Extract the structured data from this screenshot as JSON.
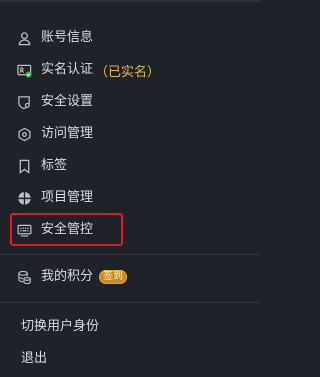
{
  "menu": {
    "account_info": {
      "label": "账号信息",
      "icon": "user-icon"
    },
    "real_name": {
      "label": "实名认证",
      "status": "（已实名）",
      "icon": "id-card-verified-icon",
      "status_color": "#e5b54f"
    },
    "security_settings": {
      "label": "安全设置",
      "icon": "shield-settings-icon"
    },
    "access_management": {
      "label": "访问管理",
      "icon": "access-management-icon"
    },
    "tags": {
      "label": "标签",
      "icon": "bookmark-icon"
    },
    "project_management": {
      "label": "项目管理",
      "icon": "project-icon"
    },
    "security_control": {
      "label": "安全管控",
      "icon": "keyboard-icon",
      "highlighted": true
    },
    "my_points": {
      "label": "我的积分",
      "badge": "签到",
      "icon": "coins-icon",
      "badge_color": "#c98a1d"
    },
    "switch_identity": {
      "label": "切换用户身份"
    },
    "logout": {
      "label": "退出"
    }
  },
  "colors": {
    "background": "#1f2329",
    "text": "#d8dbe0",
    "highlight_border": "#e01b24",
    "verified_check": "#2fb344"
  }
}
